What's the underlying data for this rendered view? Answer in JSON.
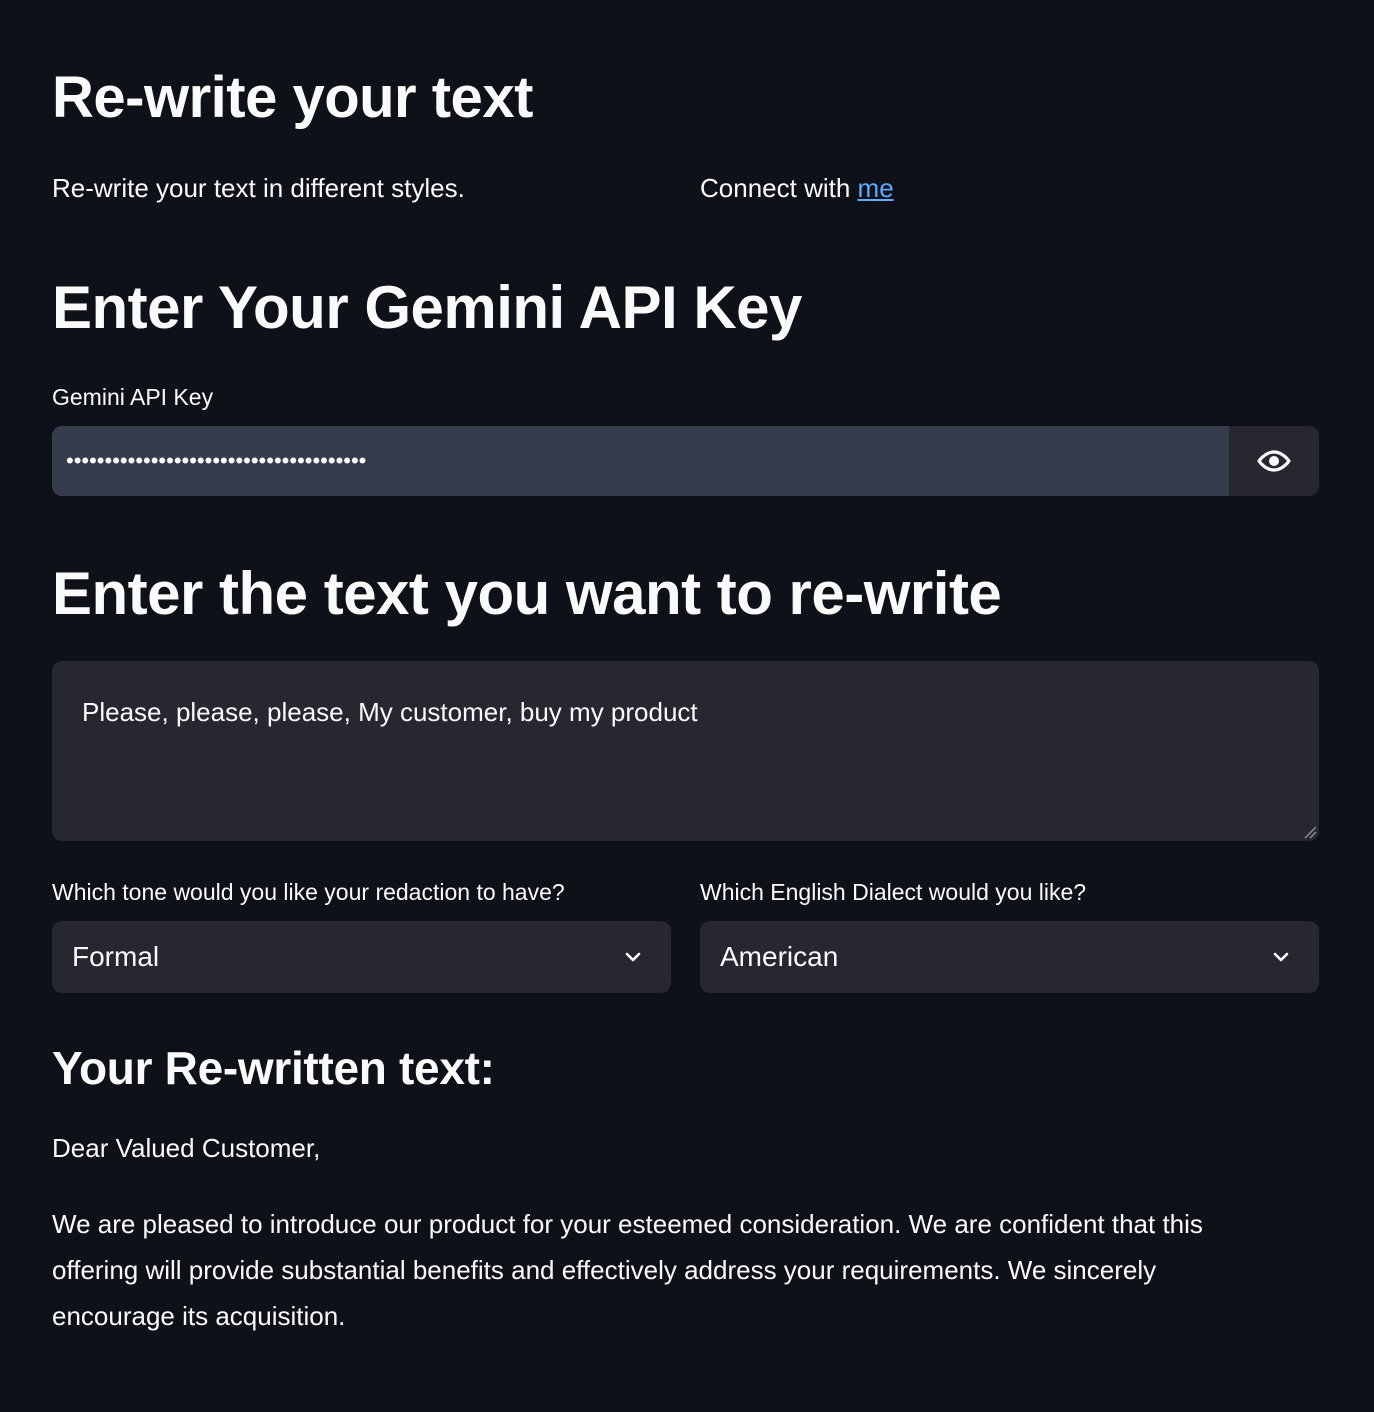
{
  "header": {
    "title": "Re-write your text",
    "subtitle": "Re-write your text in different styles.",
    "connect_prefix": "Connect with ",
    "connect_link": "me"
  },
  "api_key_section": {
    "title": "Enter Your Gemini API Key",
    "label": "Gemini API Key",
    "masked_value": "•••••••••••••••••••••••••••••••••••••••",
    "toggle_icon": "eye-icon"
  },
  "text_section": {
    "title": "Enter the text you want to re-write",
    "input_value": "Please, please, please, My customer, buy my product"
  },
  "options": {
    "tone_label": "Which tone would you like your redaction to have?",
    "tone_selected": "Formal",
    "dialect_label": "Which English Dialect would you like?",
    "dialect_selected": "American"
  },
  "result": {
    "title": "Your Re-written text:",
    "greeting": "Dear Valued Customer,",
    "body": "We are pleased to introduce our product for your esteemed consideration. We are confident that this offering will provide substantial benefits and effectively address your requirements. We sincerely encourage its acquisition."
  },
  "colors": {
    "background": "#0e1117",
    "widget": "#262730",
    "password_field": "#363c4c",
    "link": "#5fa8ff",
    "text": "#fafafa"
  }
}
